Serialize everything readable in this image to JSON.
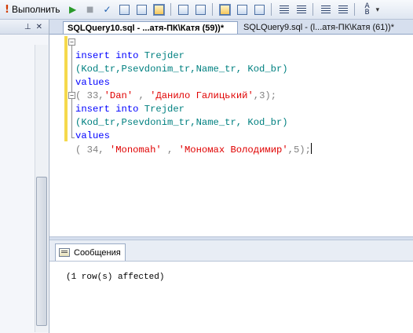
{
  "toolbar": {
    "execute_label": "Выполнить",
    "icons": [
      "execute-icon",
      "debug-play-icon",
      "stop-icon",
      "parse-check-icon",
      "display-plan-icon",
      "query-designer-icon",
      "results-to-text-icon",
      "results-to-grid-icon",
      "results-to-file-icon",
      "query-options-icon",
      "include-plan-icon",
      "comment-icon",
      "uncomment-icon",
      "decrease-indent-icon",
      "increase-indent-icon",
      "specify-values-icon"
    ]
  },
  "left_pane": {
    "header_icons": [
      "pin-icon",
      "close-icon"
    ]
  },
  "tabs": [
    {
      "label": "SQLQuery10.sql - ...атя-ПК\\Катя (59))*",
      "active": true
    },
    {
      "label": "SQLQuery9.sql - (l...атя-ПК\\Катя (61))*",
      "active": false
    }
  ],
  "editor": {
    "lines": [
      {
        "t1": "insert",
        "t2": " ",
        "t3": "into",
        "t4": " Trejder",
        "t5": "",
        "t6": "",
        "t7": ""
      },
      {
        "t1": "(Kod_tr,Psevdonim_tr,Name_tr, Kod_br)"
      },
      {
        "t1": "values"
      },
      {
        "t1": "( 33,",
        "t2": "'Dan'",
        "t3": " , ",
        "t4": "'Данило Галицький'",
        "t5": ",3);"
      },
      {
        "t1": "insert",
        "t2": " ",
        "t3": "into",
        "t4": " Trejder"
      },
      {
        "t1": "(Kod_tr,Psevdonim_tr,Name_tr, Kod_br)"
      },
      {
        "t1": "values"
      },
      {
        "t1": "( 34, ",
        "t2": "'Monomah'",
        "t3": " , ",
        "t4": "'Мономах Володимир'",
        "t5": ",5);"
      }
    ]
  },
  "results": {
    "tab_label": "Сообщения",
    "message": "(1 row(s) affected)"
  },
  "colors": {
    "keyword": "#0000ff",
    "object": "#008080",
    "string": "#e00000",
    "punct": "#808080",
    "change_bar": "#f5d94c"
  }
}
